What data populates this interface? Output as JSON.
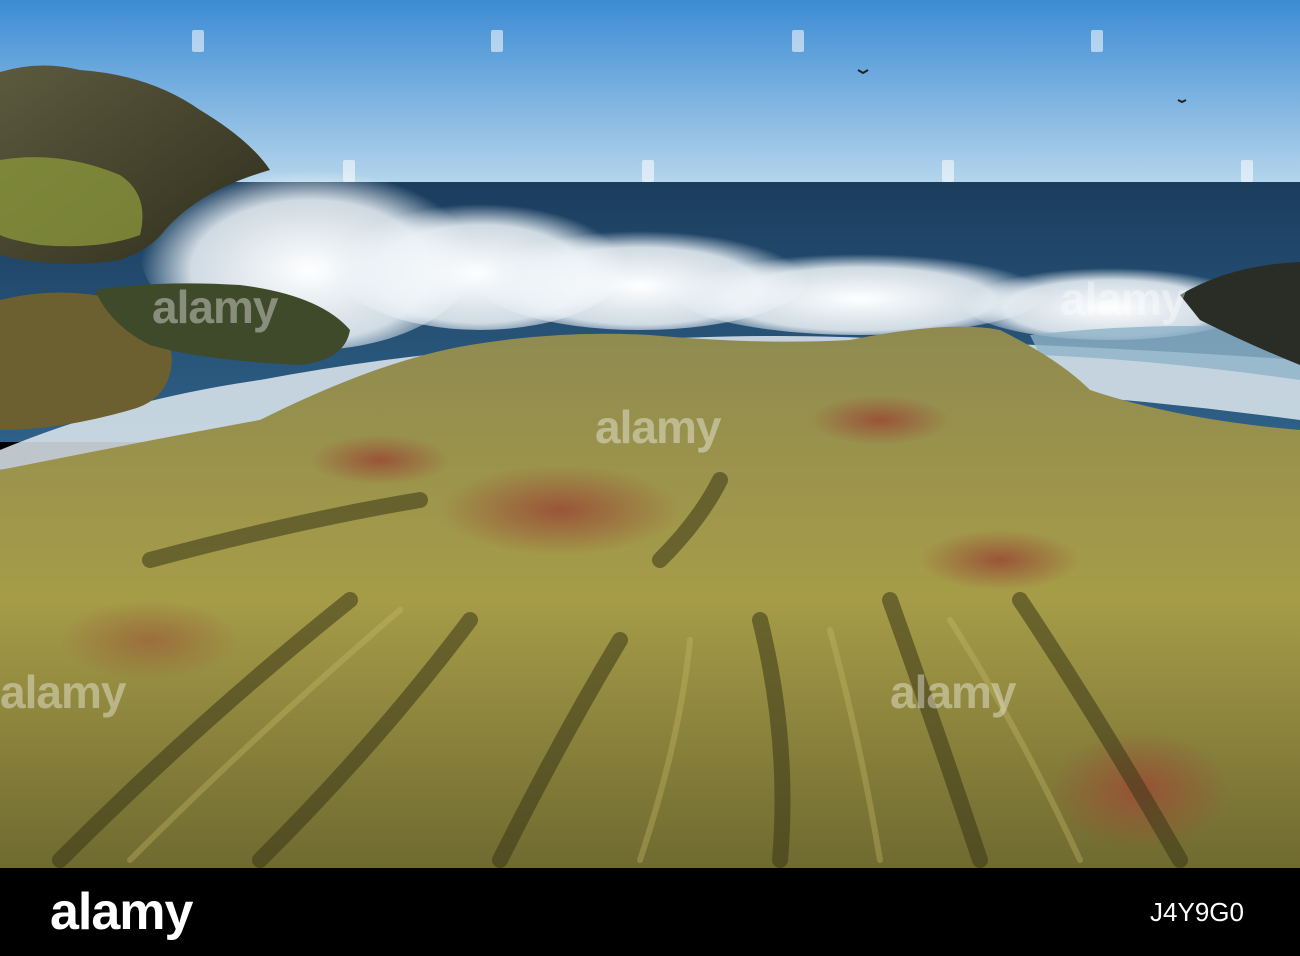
{
  "photo": {
    "subject": "waves-crashing-on-rocky-shore",
    "colors": {
      "sky_top": "#3f8ed6",
      "sky_bottom": "#a9cde8",
      "sea_deep": "#1d3f60",
      "sea_mid": "#2c5a80",
      "foam": "#f4f8fb",
      "rock_yellow": "#a59a45",
      "rock_red": "#8a4b35",
      "rock_shadow": "#3e3a1c"
    },
    "watermark_text": "alamy"
  },
  "footer": {
    "logo_text": "alamy",
    "image_id": "J4Y9G0"
  }
}
